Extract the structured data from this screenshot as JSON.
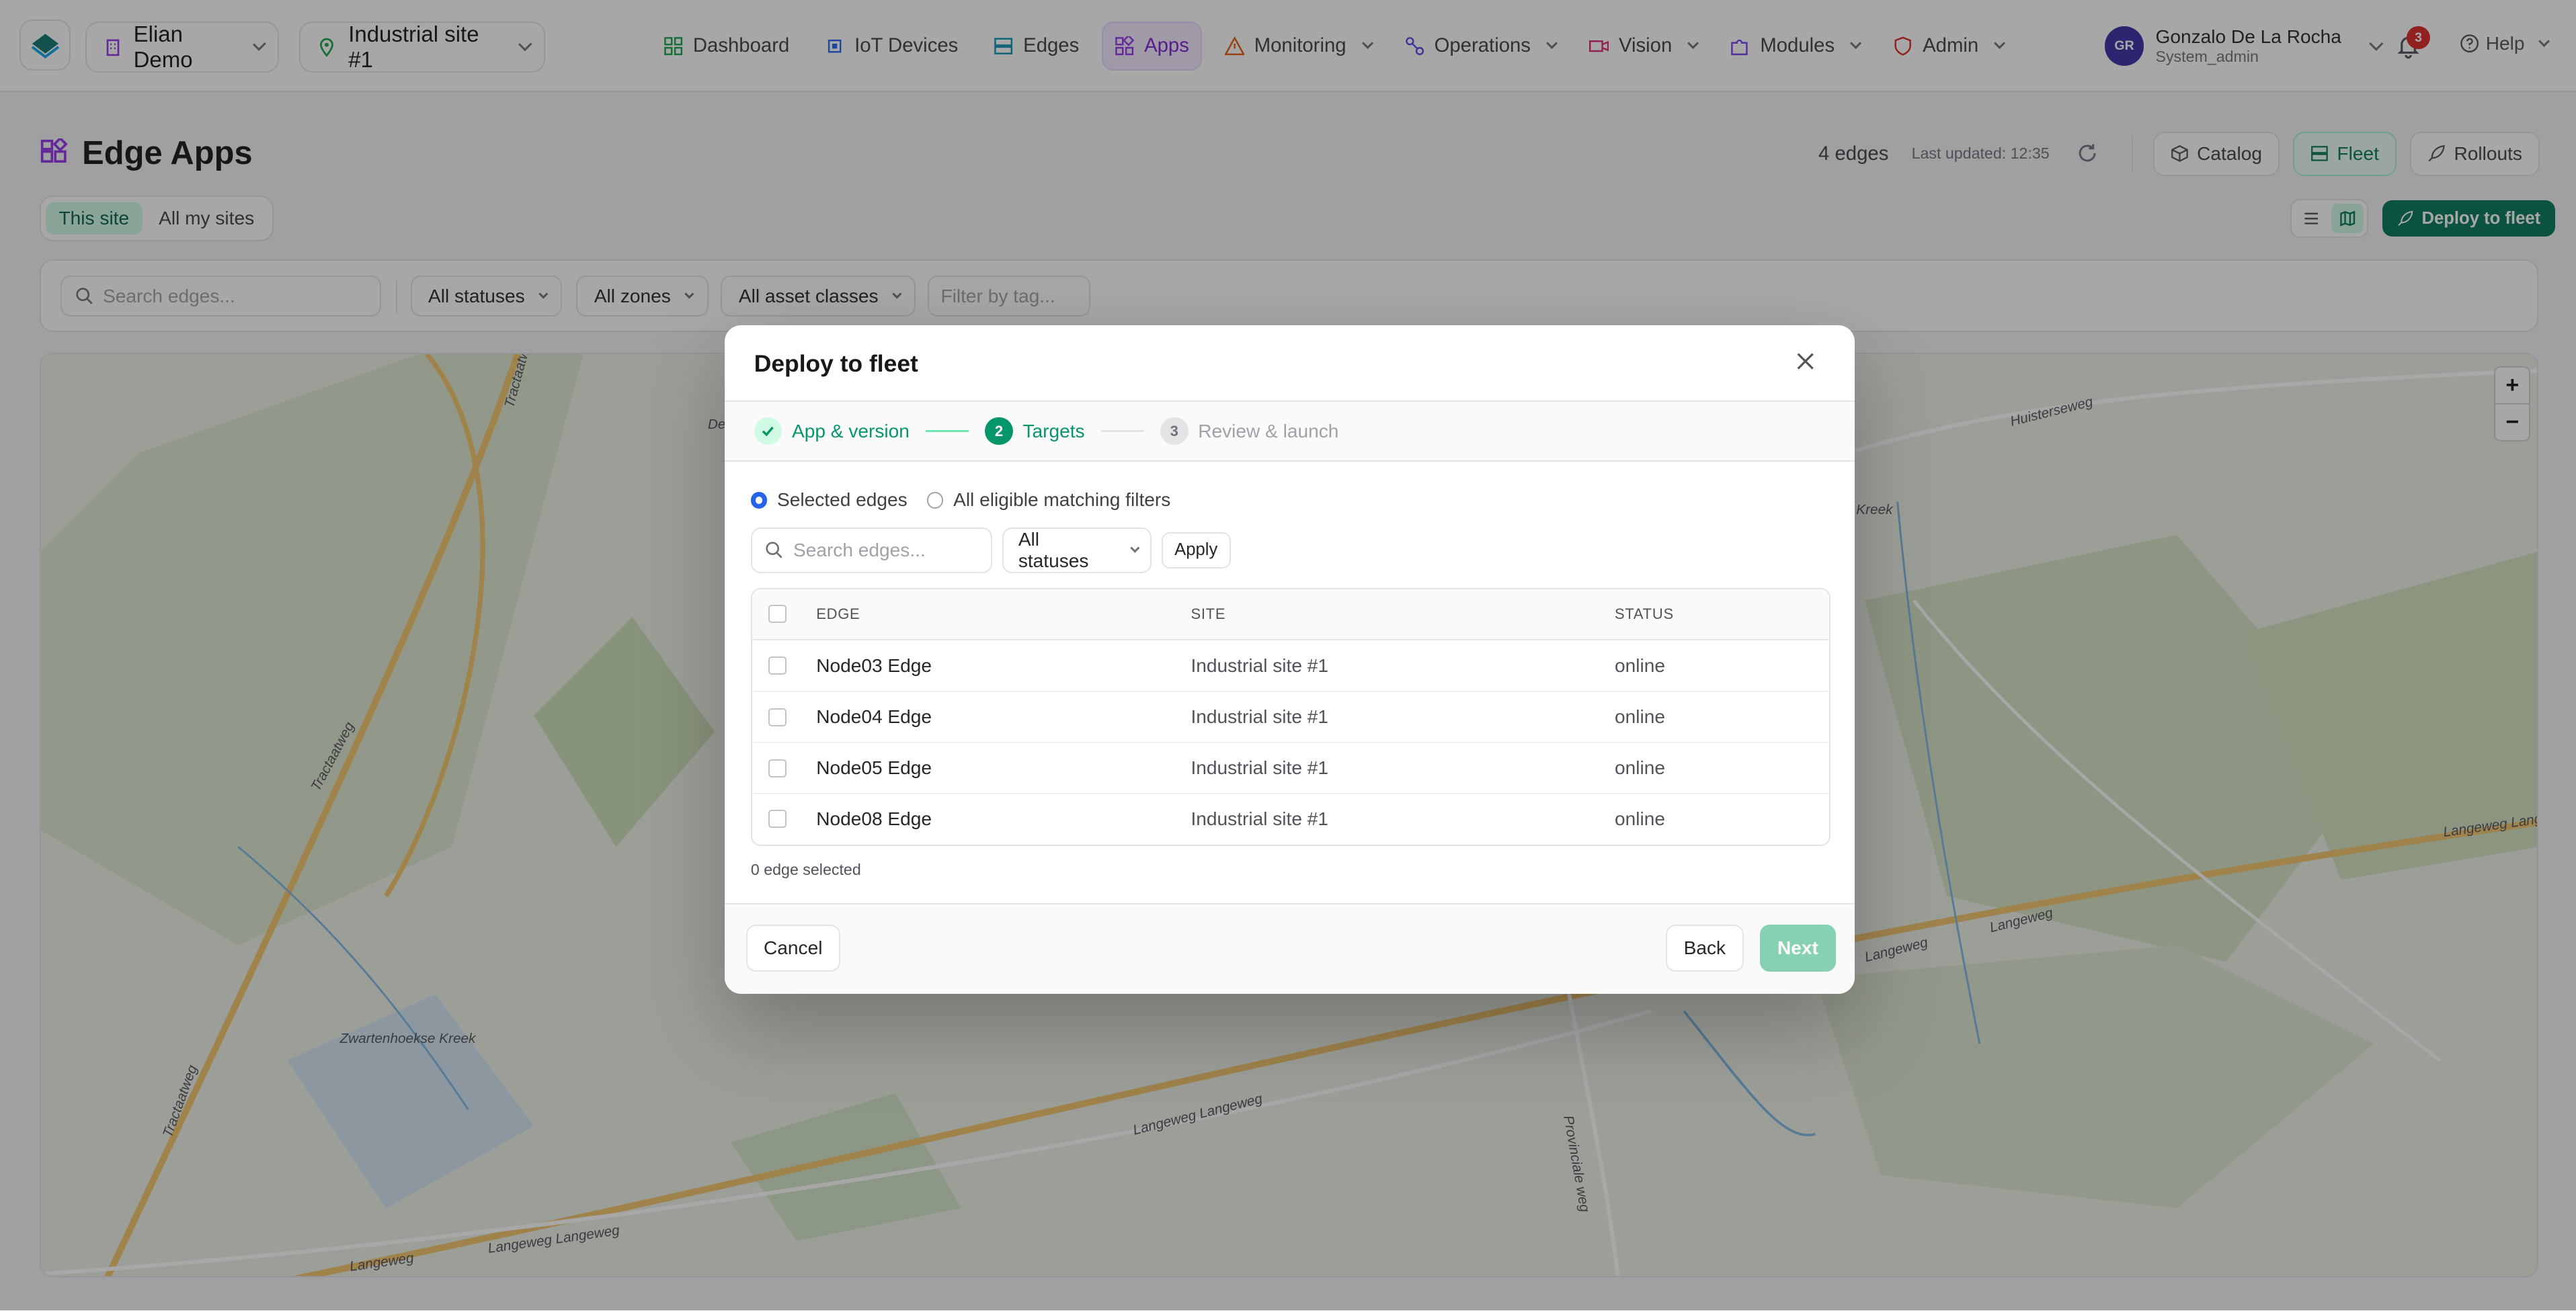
{
  "nav": {
    "org": "Elian Demo",
    "site": "Industrial site #1",
    "items": [
      {
        "label": "Dashboard",
        "icon": "dashboard-icon"
      },
      {
        "label": "IoT Devices",
        "icon": "chip-icon"
      },
      {
        "label": "Edges",
        "icon": "server-icon"
      },
      {
        "label": "Apps",
        "icon": "apps-icon"
      },
      {
        "label": "Monitoring",
        "icon": "warning-icon"
      },
      {
        "label": "Operations",
        "icon": "operations-icon"
      },
      {
        "label": "Vision",
        "icon": "camera-icon"
      },
      {
        "label": "Modules",
        "icon": "puzzle-icon"
      },
      {
        "label": "Admin",
        "icon": "shield-icon"
      }
    ],
    "active_item": "Apps",
    "user": {
      "initials": "GR",
      "name": "Gonzalo De La Rocha",
      "role": "System_admin"
    },
    "notifications": "3",
    "help": "Help"
  },
  "header": {
    "title": "Edge Apps",
    "edges_count": "4 edges",
    "last_updated": "Last updated: 12:35",
    "catalog": "Catalog",
    "fleet": "Fleet",
    "rollouts": "Rollouts",
    "scope_this": "This site",
    "scope_all": "All my sites",
    "deploy": "Deploy to fleet"
  },
  "filters": {
    "search_placeholder": "Search edges...",
    "statuses": "All statuses",
    "zones": "All zones",
    "asset_classes": "All asset classes",
    "tag_placeholder": "Filter by tag..."
  },
  "map": {
    "labels": [
      "Tractaatweg",
      "Tractaatweg",
      "Tractaatweg",
      "Zwartenhoekse Kreek",
      "Langeweg",
      "Langeweg Langeweg",
      "Langeweg Langeweg",
      "Langeweg",
      "Langeweg",
      "Langeweg Lang",
      "Huisterseweg",
      "Provinciale weg",
      "Kreek",
      "Del"
    ]
  },
  "modal": {
    "title": "Deploy to fleet",
    "steps": [
      {
        "num": "✓",
        "label": "App & version",
        "state": "done"
      },
      {
        "num": "2",
        "label": "Targets",
        "state": "current"
      },
      {
        "num": "3",
        "label": "Review & launch",
        "state": "todo"
      }
    ],
    "radio_selected": "Selected edges",
    "radio_all": "All eligible matching filters",
    "search_placeholder": "Search edges...",
    "status_filter": "All statuses",
    "apply": "Apply",
    "columns": {
      "edge": "EDGE",
      "site": "SITE",
      "status": "STATUS"
    },
    "rows": [
      {
        "edge": "Node03 Edge",
        "site": "Industrial site #1",
        "status": "online"
      },
      {
        "edge": "Node04 Edge",
        "site": "Industrial site #1",
        "status": "online"
      },
      {
        "edge": "Node05 Edge",
        "site": "Industrial site #1",
        "status": "online"
      },
      {
        "edge": "Node08 Edge",
        "site": "Industrial site #1",
        "status": "online"
      }
    ],
    "selected_count": "0 edge selected",
    "cancel": "Cancel",
    "back": "Back",
    "next": "Next"
  },
  "colors": {
    "brand_green": "#047857",
    "apps_purple": "#7e22ce",
    "notification_red": "#dc2626"
  }
}
